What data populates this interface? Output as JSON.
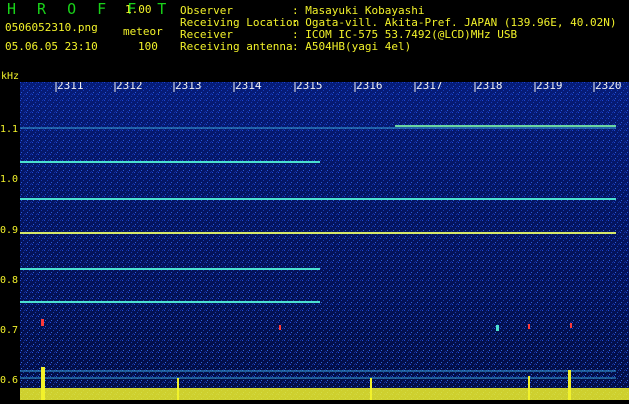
{
  "header": {
    "app_title": "H R O F F T",
    "app_version": "1.00",
    "filename": "0506052310.png",
    "datetime": "05.06.05 23:10",
    "mode_label": "meteor",
    "mode_value": "100"
  },
  "meta": [
    {
      "key": "Observer",
      "value": ": Masayuki Kobayashi"
    },
    {
      "key": "Receiving Location",
      "value": ": Ogata-vill. Akita-Pref. JAPAN (139.96E, 40.02N)"
    },
    {
      "key": "Receiver",
      "value": ": ICOM IC-575 53.7492(@LCD)MHz USB"
    },
    {
      "key": "Receiving antenna",
      "value": ": A504HB(yagi 4el)"
    }
  ],
  "spectrogram": {
    "y_unit": "kHz",
    "y_ticks": [
      "1.1",
      "1.0",
      "0.9",
      "0.8",
      "0.7",
      "0.6"
    ],
    "time_ticks": [
      "2311",
      "2312",
      "2313",
      "2314",
      "2315",
      "2316",
      "2317",
      "2318",
      "2319",
      "2320"
    ],
    "colors": {
      "background": "#020a3a",
      "noise": "#1e4cc8",
      "line": "#4be0d0",
      "axis_text": "#f2f22a"
    }
  }
}
